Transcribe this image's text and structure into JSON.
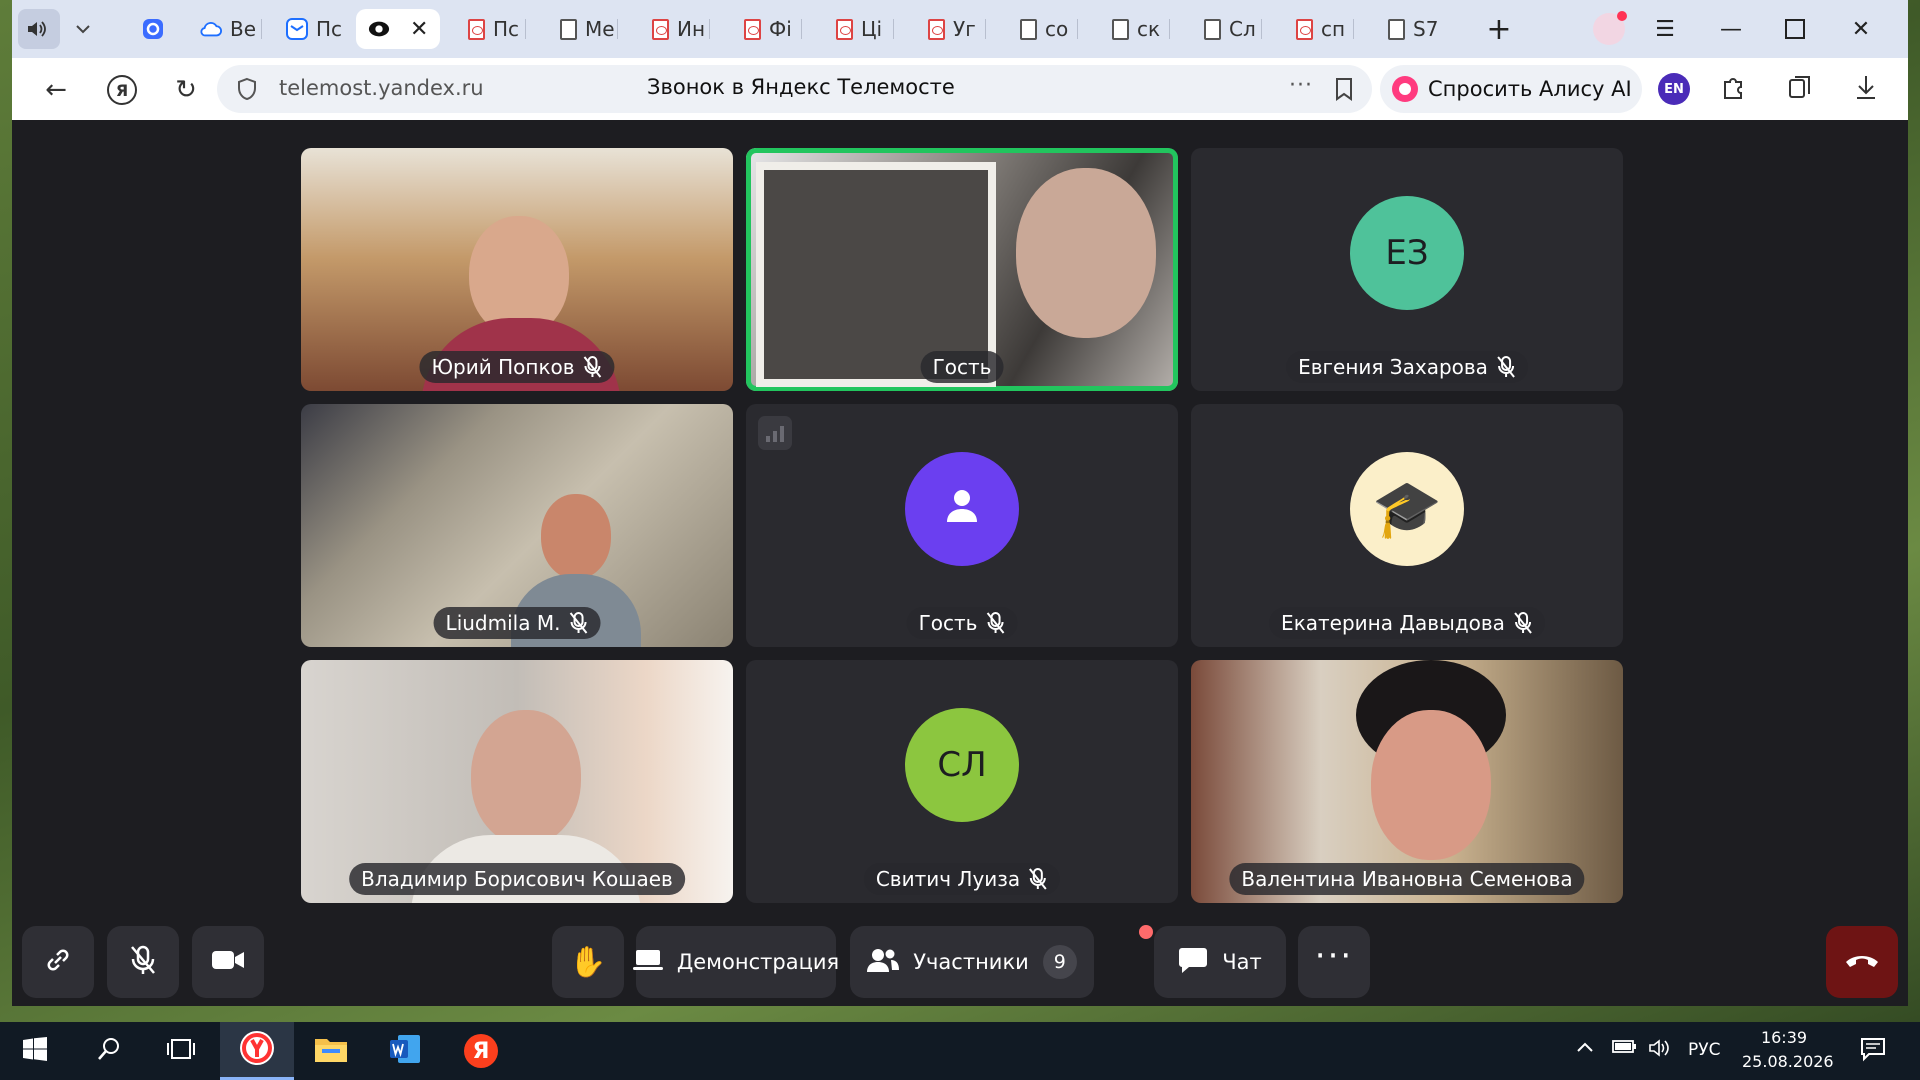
{
  "browser": {
    "tabs": [
      {
        "label": "",
        "icon": "speaker-icon",
        "kind": "audio"
      },
      {
        "label": "",
        "icon": "chevron-down-icon",
        "kind": "menu"
      },
      {
        "label": "",
        "icon": "app-icon",
        "kind": "pinned"
      },
      {
        "label": "Ве",
        "icon": "cloud-icon",
        "kind": "tab"
      },
      {
        "label": "Пс",
        "icon": "mail-icon",
        "kind": "tab"
      },
      {
        "label": "",
        "icon": "telemost-icon",
        "kind": "active"
      },
      {
        "label": "Пс",
        "icon": "pdf-icon",
        "kind": "tab"
      },
      {
        "label": "Ме",
        "icon": "doc-icon",
        "kind": "tab"
      },
      {
        "label": "Ин",
        "icon": "pdf-icon",
        "kind": "tab"
      },
      {
        "label": "Фі",
        "icon": "pdf-icon",
        "kind": "tab"
      },
      {
        "label": "Ці",
        "icon": "pdf-icon",
        "kind": "tab"
      },
      {
        "label": "Уг",
        "icon": "pdf-icon",
        "kind": "tab"
      },
      {
        "label": "со",
        "icon": "doc-icon",
        "kind": "tab"
      },
      {
        "label": "ск",
        "icon": "doc-icon",
        "kind": "tab"
      },
      {
        "label": "Сл",
        "icon": "doc-icon",
        "kind": "tab"
      },
      {
        "label": "сп",
        "icon": "pdf-icon",
        "kind": "tab"
      },
      {
        "label": "S7",
        "icon": "doc-icon",
        "kind": "tab"
      }
    ],
    "url": "telemost.yandex.ru",
    "page_title": "Звонок в Яндекс Телемосте",
    "alice_label": "Спросить Алису AI",
    "lang_badge": "EN"
  },
  "participants": [
    {
      "name": "Юрий Попков",
      "muted": true,
      "type": "video",
      "bg": "#8a6a52"
    },
    {
      "name": "Гость",
      "muted": false,
      "type": "video",
      "speaking": true,
      "bg": "#6d6a66"
    },
    {
      "name": "Евгения Захарова",
      "muted": true,
      "type": "initials",
      "initials": "ЕЗ",
      "color": "#4fc29a"
    },
    {
      "name": "Liudmila M.",
      "muted": true,
      "type": "video",
      "bg": "#7e776c"
    },
    {
      "name": "Гость",
      "muted": true,
      "type": "guest",
      "color": "#6b3ff0"
    },
    {
      "name": "Екатерина Давыдова",
      "muted": true,
      "type": "emoji",
      "emoji": "🎓",
      "color": "#fbefc9"
    },
    {
      "name": "Владимир Борисович Кошаев",
      "muted": false,
      "type": "video",
      "bg": "#c9c4bf"
    },
    {
      "name": "Свитич Луиза",
      "muted": true,
      "type": "initials",
      "initials": "СЛ",
      "color": "#8cc63f"
    },
    {
      "name": "Валентина Ивановна Семенова",
      "muted": false,
      "type": "video",
      "bg": "#8e7a66"
    }
  ],
  "toolbar": {
    "demo_label": "Демонстрация",
    "participants_label": "Участники",
    "participants_count": "9",
    "chat_label": "Чат"
  },
  "taskbar": {
    "lang": "РУС",
    "time": "16:39",
    "date": "25.08.2026"
  },
  "colors": {
    "speaking_border": "#22c55e",
    "hangup": "#6e1414",
    "tile_bg": "#2a2a2f"
  }
}
